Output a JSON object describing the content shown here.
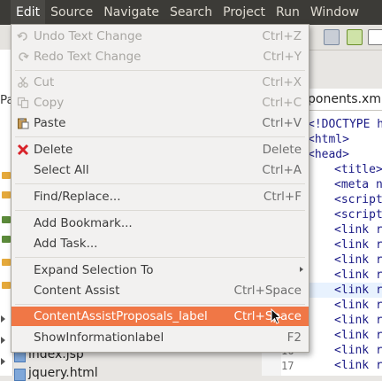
{
  "menubar": {
    "items": [
      {
        "label": "Edit",
        "active": true
      },
      {
        "label": "Source"
      },
      {
        "label": "Navigate"
      },
      {
        "label": "Search"
      },
      {
        "label": "Project"
      },
      {
        "label": "Run"
      },
      {
        "label": "Window"
      }
    ]
  },
  "left_panel": {
    "tab_label": "Pa",
    "files": [
      "index.jsp",
      "jquery.html"
    ]
  },
  "editor": {
    "tab_label": "ponents.xml",
    "line_numbers": [
      "16",
      "17"
    ],
    "code_lines": [
      "<!DOCTYPE h",
      "<html>",
      "<head>",
      "<title>",
      "<meta n",
      "<script",
      "<script",
      "<link r",
      "<link r",
      "<link r",
      "<link r",
      "<link r",
      "<link r",
      "<link r",
      "<link r",
      "<link r",
      "<link r"
    ]
  },
  "edit_menu": {
    "undo": {
      "label": "Undo Text Change",
      "accel": "Ctrl+Z"
    },
    "redo": {
      "label": "Redo Text Change",
      "accel": "Ctrl+Y"
    },
    "cut": {
      "label": "Cut",
      "accel": "Ctrl+X"
    },
    "copy": {
      "label": "Copy",
      "accel": "Ctrl+C"
    },
    "paste": {
      "label": "Paste",
      "accel": "Ctrl+V"
    },
    "delete": {
      "label": "Delete",
      "accel": "Delete"
    },
    "select_all": {
      "label": "Select All",
      "accel": "Ctrl+A"
    },
    "find_replace": {
      "label": "Find/Replace...",
      "accel": "Ctrl+F"
    },
    "add_bookmark": {
      "label": "Add Bookmark..."
    },
    "add_task": {
      "label": "Add Task..."
    },
    "expand_selection": {
      "label": "Expand Selection To"
    },
    "content_assist": {
      "label": "Content Assist",
      "accel": "Ctrl+Space"
    },
    "content_assist_proposals": {
      "label": "ContentAssistProposals_label",
      "accel": "Ctrl+Space"
    },
    "show_information": {
      "label": "ShowInformationlabel",
      "accel": "F2"
    }
  },
  "colors": {
    "menubar_bg": "#3c3b37",
    "selection_accent": "#f07746",
    "delete_icon": "#d8232a"
  }
}
